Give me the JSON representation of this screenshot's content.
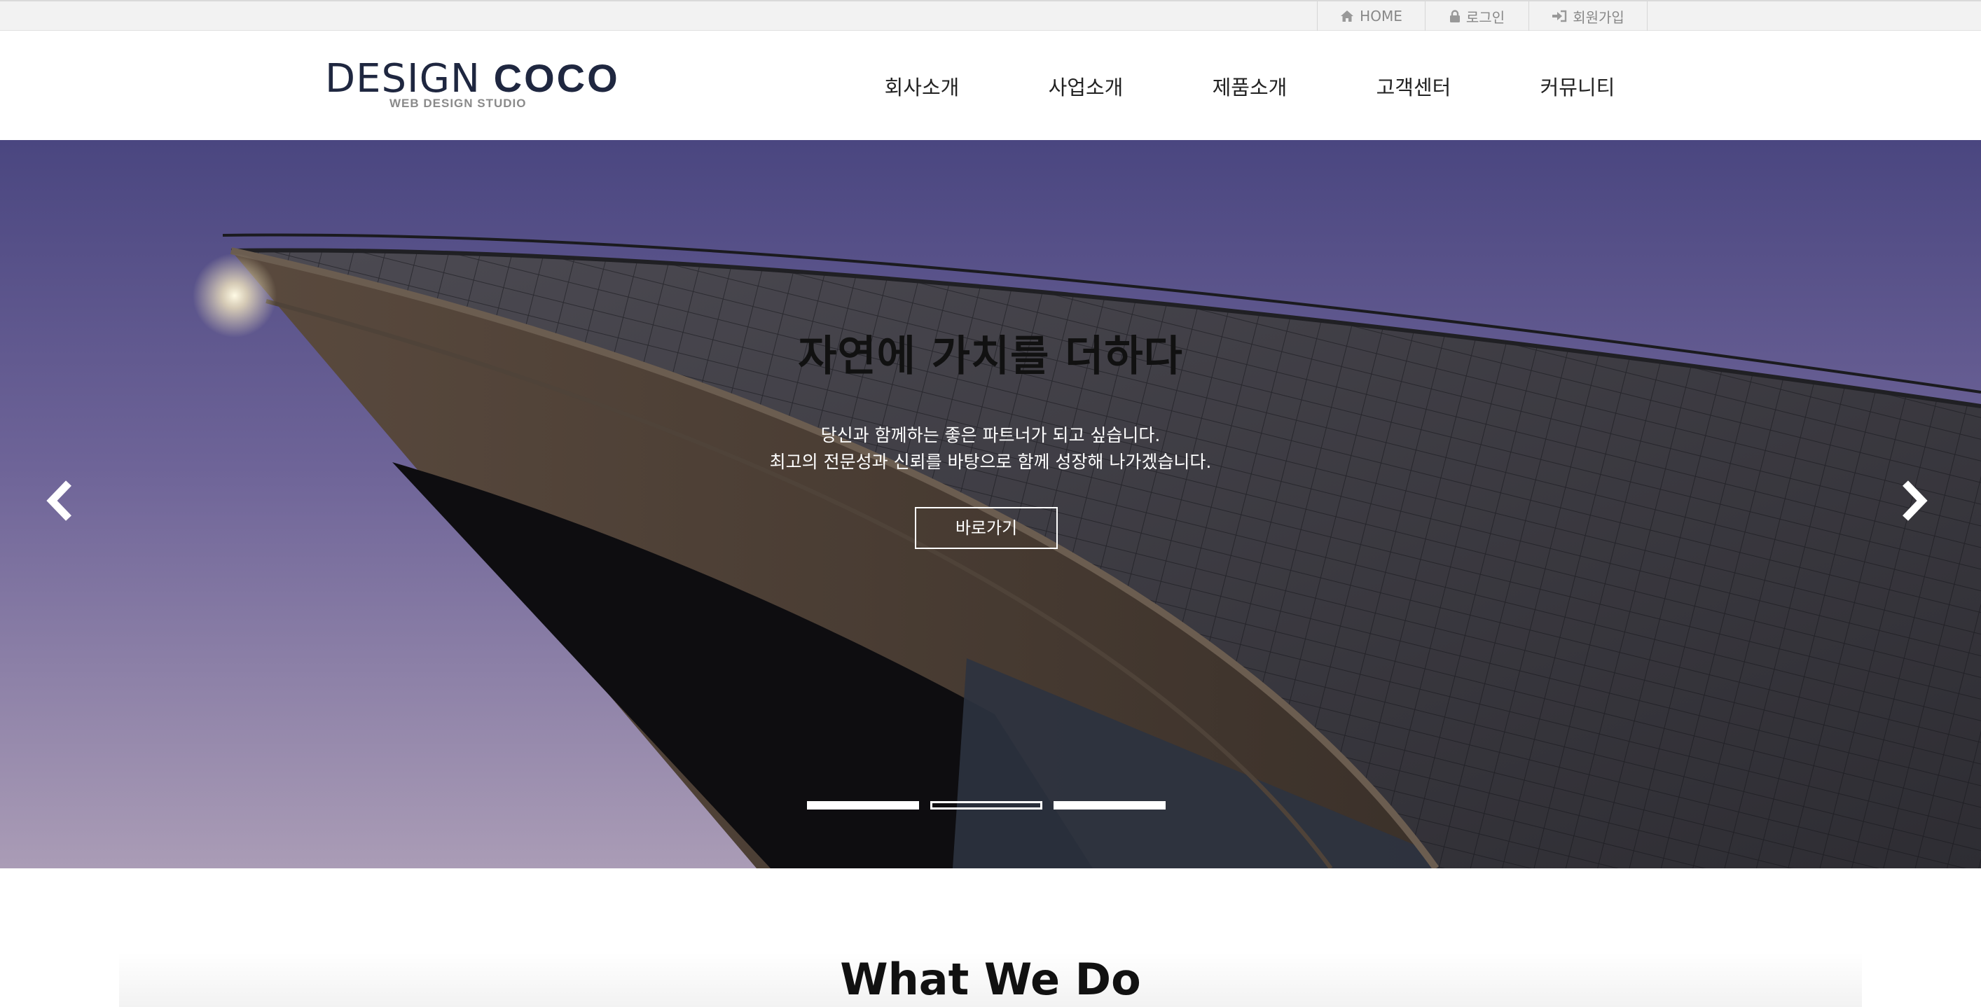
{
  "topbar": {
    "items": [
      {
        "label": "HOME",
        "icon": "home-icon"
      },
      {
        "label": "로그인",
        "icon": "lock-icon"
      },
      {
        "label": "회원가입",
        "icon": "sign-in-icon"
      }
    ]
  },
  "logo": {
    "word1": "DESIGN",
    "word2": "COCO",
    "tagline": "WEB DESIGN STUDIO"
  },
  "nav": {
    "items": [
      "회사소개",
      "사업소개",
      "제품소개",
      "고객센터",
      "커뮤니티"
    ]
  },
  "hero": {
    "title": "자연에 가치를 더하다",
    "line1": "당신과 함께하는 좋은 파트너가 되고 싶습니다.",
    "line2": "최고의 전문성과 신뢰를 바탕으로 함께 성장해 나가겠습니다.",
    "button": "바로가기",
    "prev_icon": "chevron-left-icon",
    "next_icon": "chevron-right-icon",
    "slide_count": 3,
    "active_slide": 2
  },
  "section": {
    "title": "What We Do"
  },
  "colors": {
    "brand_navy": "#1f2740",
    "sky_top": "#4f4a82",
    "sky_bottom": "#a89ab4"
  }
}
